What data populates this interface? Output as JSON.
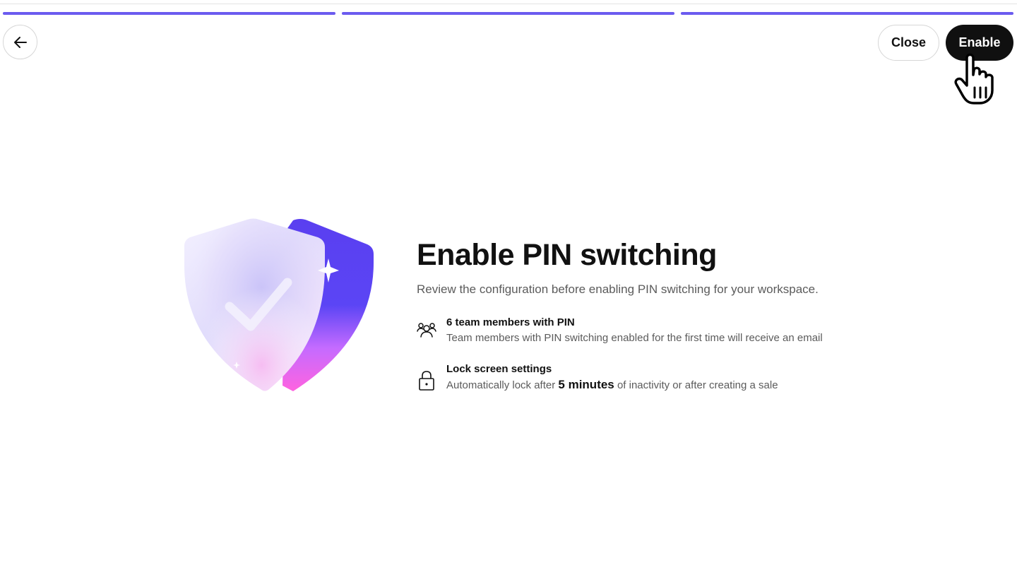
{
  "progress": {
    "steps": 3,
    "completed": 3,
    "color": "#6b5bef"
  },
  "header": {
    "back_icon": "arrow-left-icon",
    "close_label": "Close",
    "enable_label": "Enable"
  },
  "cursor": {
    "icon": "hand-pointer-icon"
  },
  "illustration": {
    "icon": "shield-check-icon",
    "accent_colors": [
      "#5b3ff0",
      "#ff6fe6"
    ]
  },
  "main": {
    "title": "Enable PIN switching",
    "subtitle": "Review the configuration before enabling PIN switching for your workspace.",
    "items": [
      {
        "icon": "team-members-icon",
        "title": "6 team members with PIN",
        "description": "Team members with PIN switching enabled for the first time will receive an email"
      },
      {
        "icon": "lock-icon",
        "title": "Lock screen settings",
        "description_prefix": "Automatically lock after",
        "description_emphasis": "5 minutes",
        "description_suffix": "of inactivity or after creating a sale"
      }
    ]
  }
}
